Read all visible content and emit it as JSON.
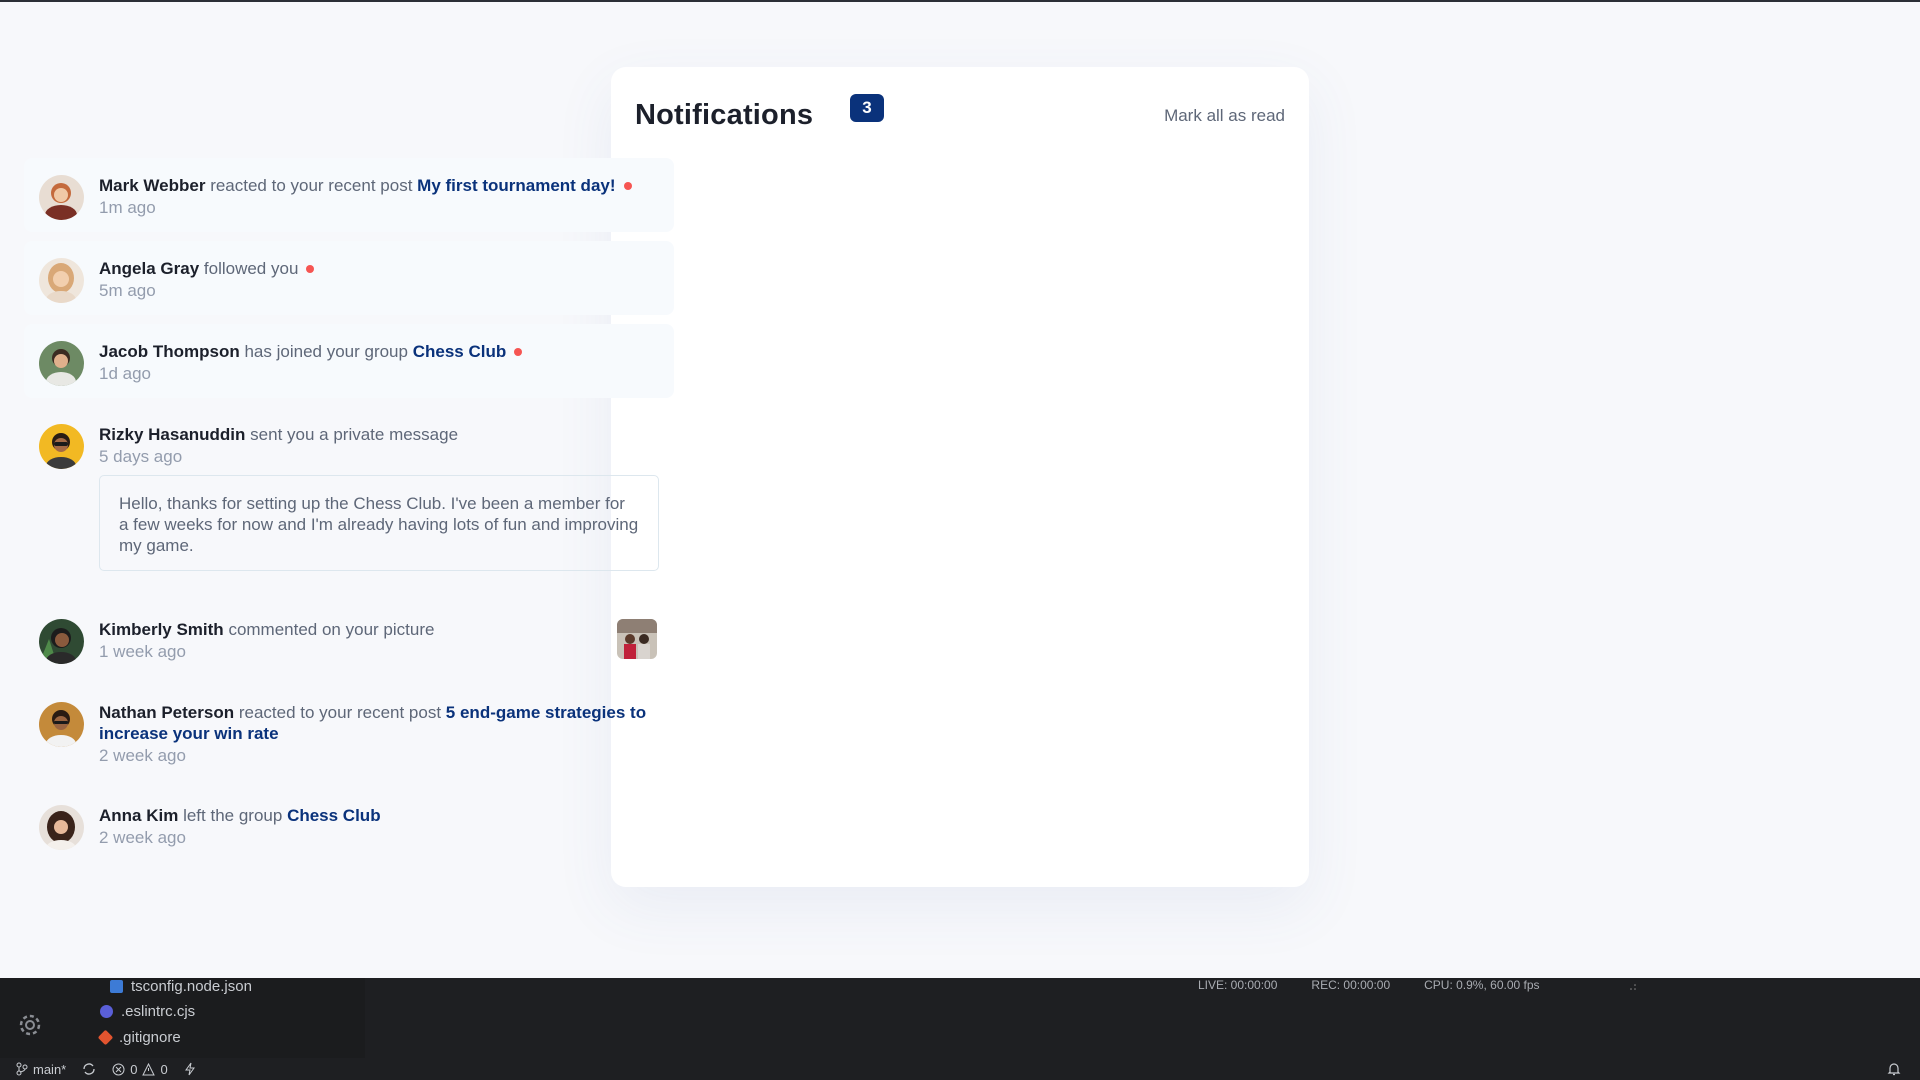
{
  "header": {
    "title": "Notifications",
    "unread_count": "3",
    "mark_all_label": "Mark all as read"
  },
  "notifications": [
    {
      "name": "Mark Webber",
      "action": "reacted to your recent post",
      "target": "My first tournament day!",
      "time": "1m ago",
      "unread": true
    },
    {
      "name": "Angela Gray",
      "action": "followed you",
      "target": "",
      "time": "5m ago",
      "unread": true
    },
    {
      "name": "Jacob Thompson",
      "action": "has joined your group",
      "target": "Chess Club",
      "time": "1d ago",
      "unread": true
    },
    {
      "name": "Rizky Hasanuddin",
      "action": "sent you a private message",
      "target": "",
      "time": "5 days ago",
      "unread": false,
      "message": "Hello, thanks for setting up the Chess Club. I've been a member for a few weeks for now and I'm already having lots of fun and improving my game."
    },
    {
      "name": "Kimberly Smith",
      "action": "commented on your picture",
      "target": "",
      "time": "1 week ago",
      "unread": false
    },
    {
      "name": "Nathan Peterson",
      "action": "reacted to your recent post",
      "target": "5 end-game strategies to increase your win rate",
      "time": "2 week ago",
      "unread": false
    },
    {
      "name": "Anna Kim",
      "action": "left the group",
      "target": "Chess Club",
      "time": "2 week ago",
      "unread": false
    }
  ],
  "ide": {
    "files": [
      "tsconfig.node.json",
      ".eslintrc.cjs",
      ".gitignore"
    ],
    "live": "LIVE: 00:00:00",
    "rec": "REC: 00:00:00",
    "cpu": "CPU: 0.9%, 60.00 fps",
    "branch": "main*",
    "errors": "0",
    "warnings": "0"
  },
  "colors": {
    "accent": "#0a327b",
    "unread_dot": "#f65552",
    "unread_bg": "#f7fafd"
  }
}
